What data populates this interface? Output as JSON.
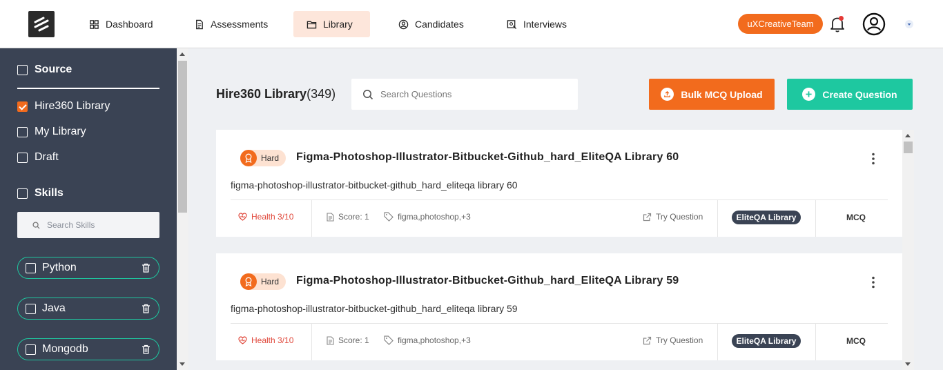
{
  "header": {
    "nav": [
      {
        "label": "Dashboard",
        "icon": "grid-icon"
      },
      {
        "label": "Assessments",
        "icon": "document-icon"
      },
      {
        "label": "Library",
        "icon": "folder-icon",
        "active": true
      },
      {
        "label": "Candidates",
        "icon": "user-circle-icon"
      },
      {
        "label": "Interviews",
        "icon": "interview-icon"
      }
    ],
    "team": "uXCreativeTeam"
  },
  "sidebar": {
    "source_label": "Source",
    "sources": [
      {
        "label": "Hire360 Library",
        "checked": true
      },
      {
        "label": "My Library",
        "checked": false
      },
      {
        "label": "Draft",
        "checked": false
      }
    ],
    "skills_label": "Skills",
    "skills_search_placeholder": "Search Skills",
    "skills": [
      {
        "label": "Python"
      },
      {
        "label": "Java"
      },
      {
        "label": "Mongodb"
      }
    ]
  },
  "main": {
    "title": "Hire360 Library",
    "count": "(349)",
    "search_placeholder": "Search Questions",
    "bulk_upload_label": "Bulk MCQ Upload",
    "create_label": "Create Question",
    "questions": [
      {
        "difficulty": "Hard",
        "title": "Figma-Photoshop-Illustrator-Bitbucket-Github_hard_EliteQA Library 60",
        "description": "figma-photoshop-illustrator-bitbucket-github_hard_eliteqa library 60",
        "health": "Health 3/10",
        "score": "Score: 1",
        "tags": "figma,photoshop,+3",
        "try_label": "Try Question",
        "library": "EliteQA Library",
        "type": "MCQ"
      },
      {
        "difficulty": "Hard",
        "title": "Figma-Photoshop-Illustrator-Bitbucket-Github_hard_EliteQA Library 59",
        "description": "figma-photoshop-illustrator-bitbucket-github_hard_eliteqa library 59",
        "health": "Health 3/10",
        "score": "Score: 1",
        "tags": "figma,photoshop,+3",
        "try_label": "Try Question",
        "library": "EliteQA Library",
        "type": "MCQ"
      }
    ]
  },
  "colors": {
    "accent": "#f26b1d",
    "teal": "#1ec8a0",
    "sidebar": "#3a4354"
  }
}
